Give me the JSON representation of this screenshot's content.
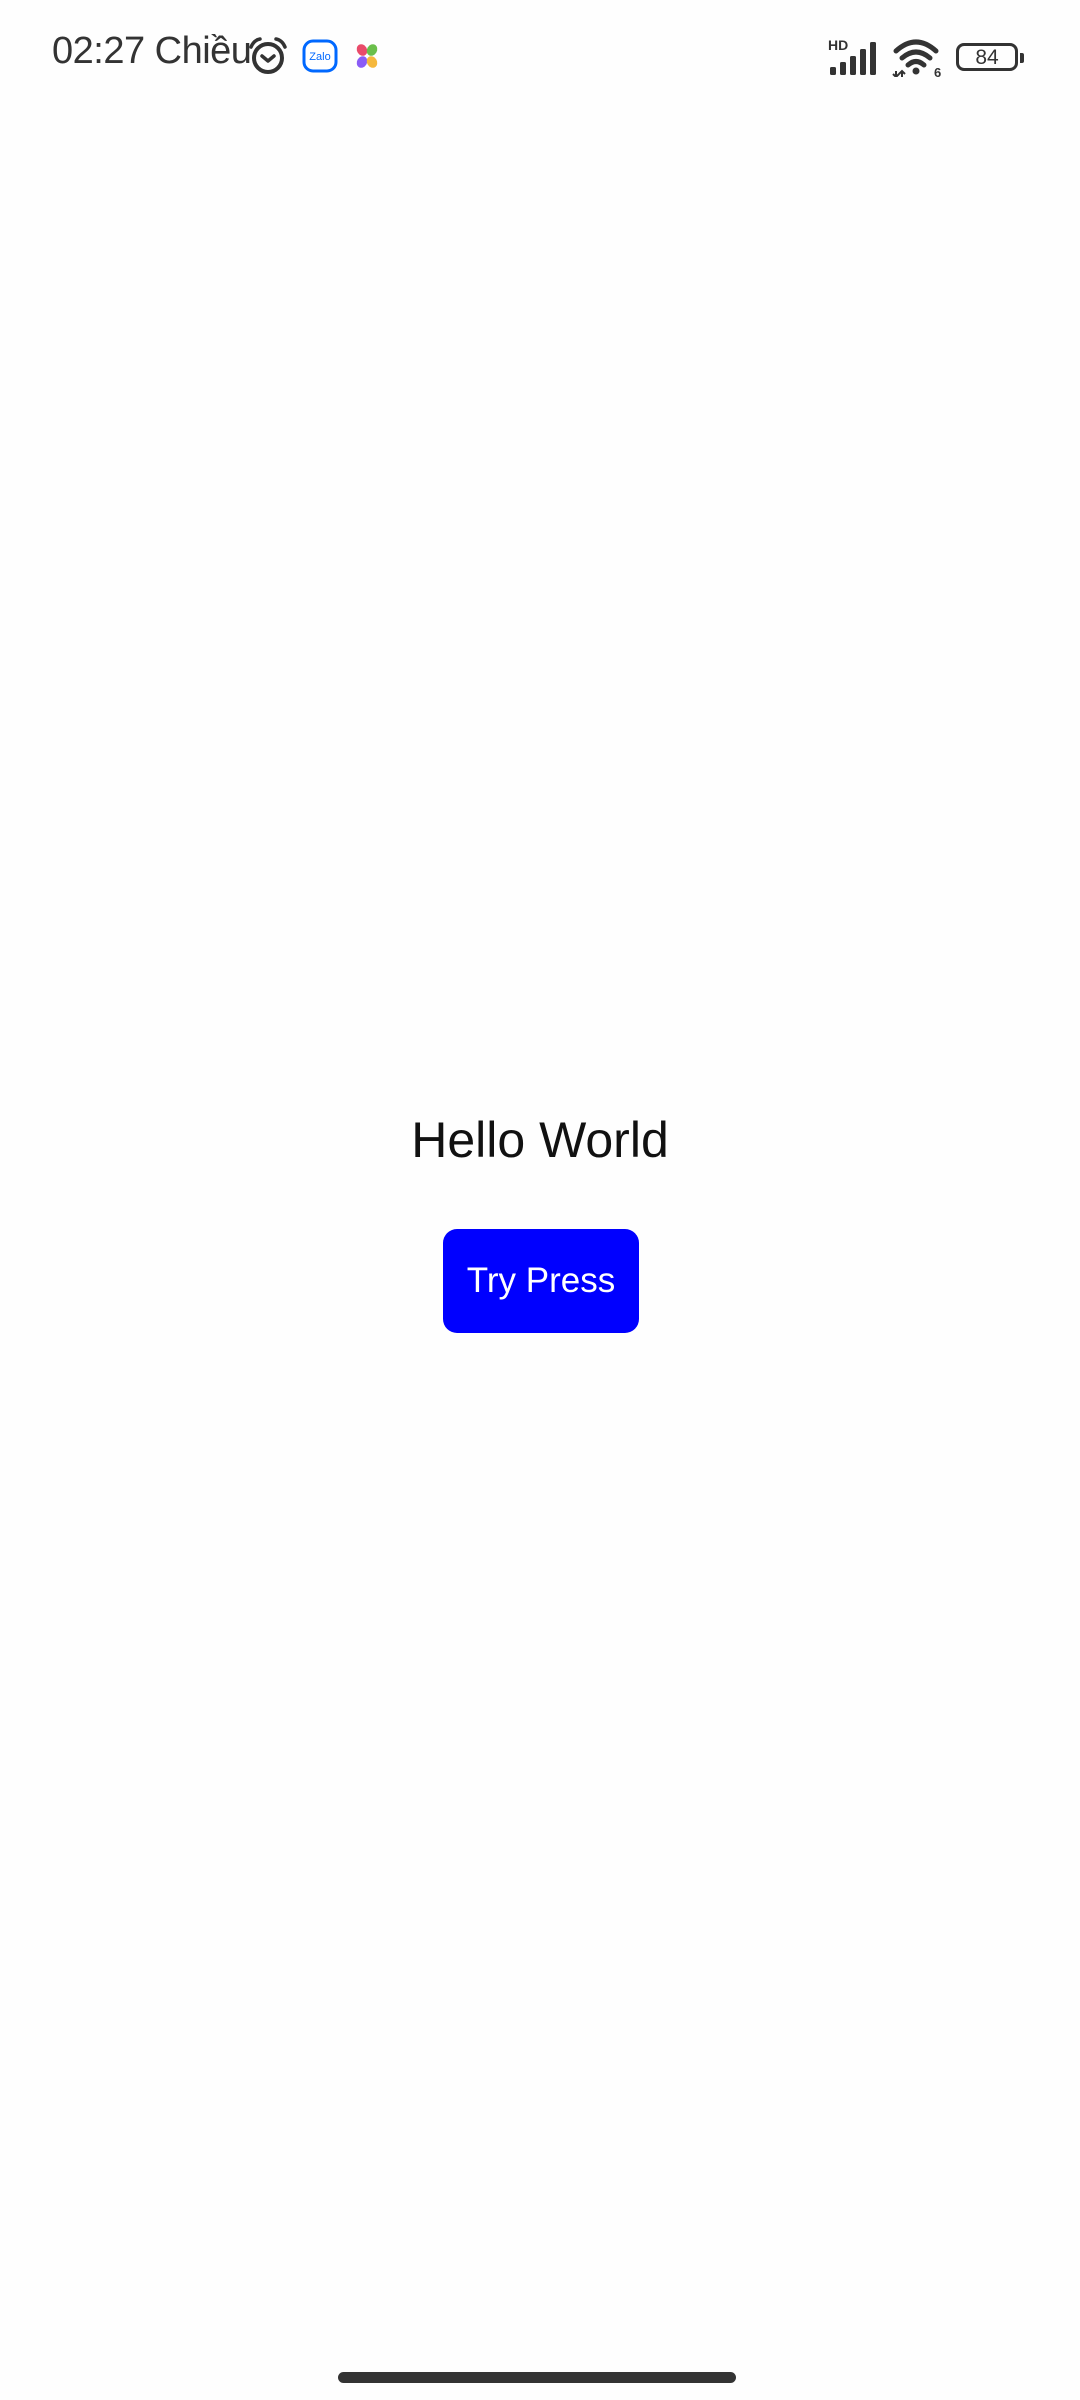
{
  "status_bar": {
    "time": "02:27 Chiều",
    "zalo_label": "Zalo",
    "network_label": "HD",
    "wifi_label": "6",
    "battery_level": "84",
    "icons": [
      "alarm-icon",
      "zalo-icon",
      "app-icon",
      "signal-icon",
      "wifi-icon",
      "battery-icon"
    ]
  },
  "main": {
    "greeting": "Hello World",
    "button_label": "Try Press",
    "button_color": "#0000ff"
  }
}
